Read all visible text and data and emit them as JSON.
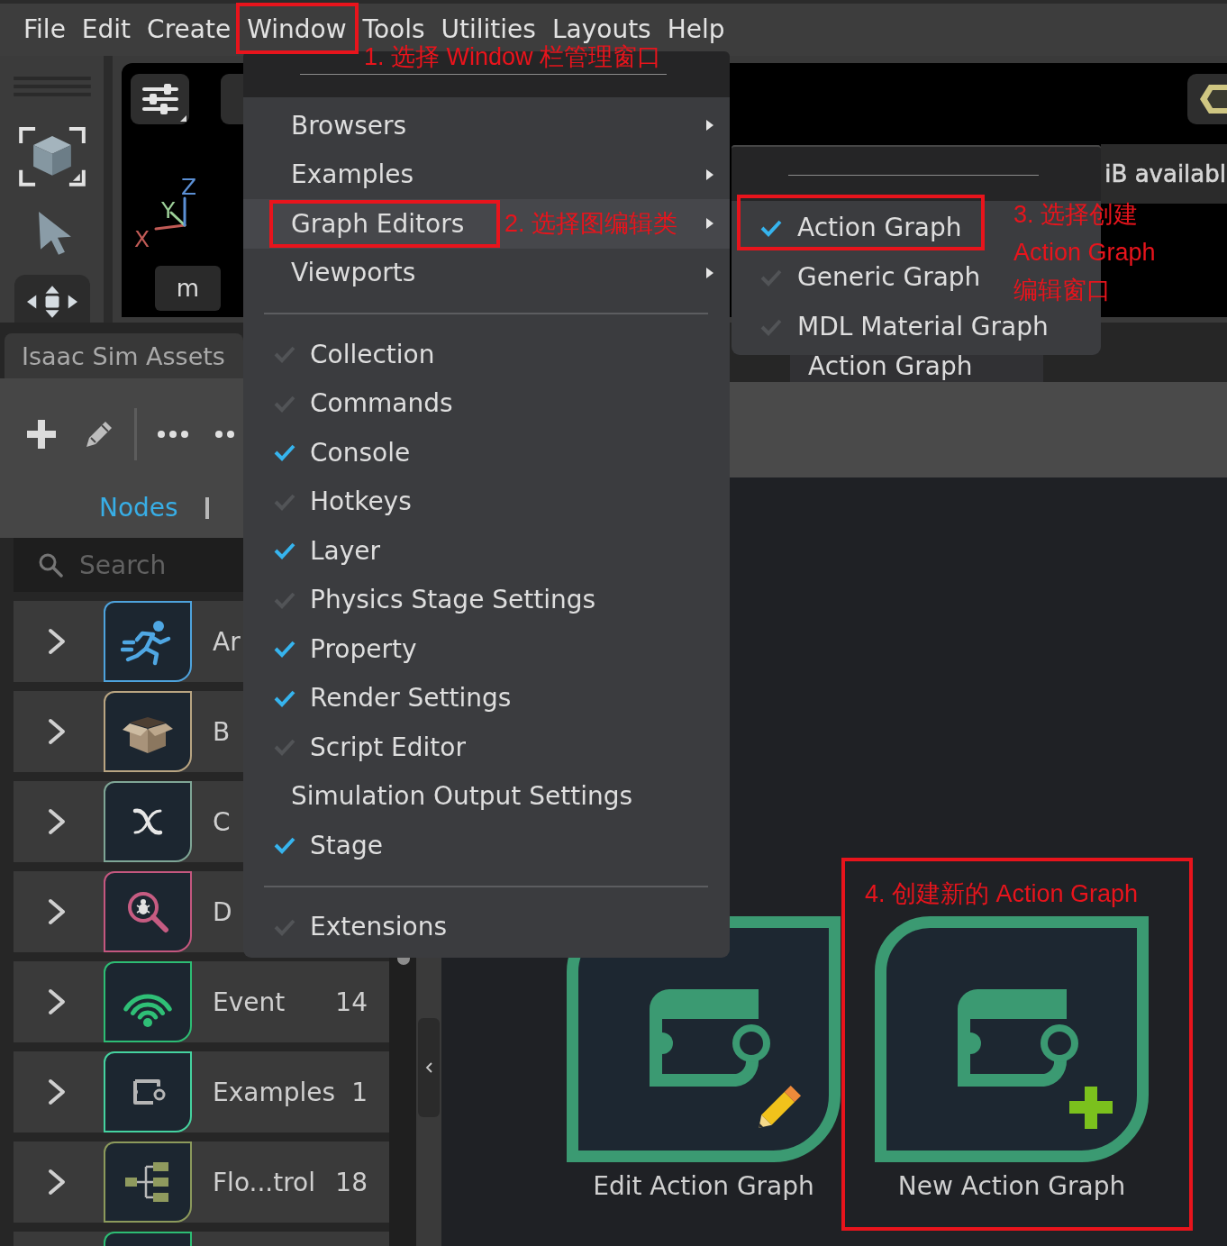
{
  "menu_bar": [
    "File",
    "Edit",
    "Create",
    "Window",
    "Tools",
    "Utilities",
    "Layouts",
    "Help"
  ],
  "viewport": {
    "axes": [
      {
        "label": "X",
        "color": "#c05a55"
      },
      {
        "label": "Y",
        "color": "#9ccf98"
      },
      {
        "label": "Z",
        "color": "#5b8fd4"
      }
    ],
    "units": "m",
    "hud_text": "iB availabl"
  },
  "assets_panel": {
    "tab": "Isaac Sim Assets",
    "view_tabs": [
      {
        "label": "Nodes",
        "selected": true
      }
    ],
    "search": {
      "placeholder": "Search"
    },
    "rows": [
      {
        "kind": "runner",
        "label": "Ar",
        "color": "#4ea3dd"
      },
      {
        "kind": "box",
        "label": "B",
        "color": "#b9a582"
      },
      {
        "kind": "x",
        "label": "C",
        "color": "#7fa696"
      },
      {
        "kind": "bug",
        "label": "D",
        "color": "#c4577f"
      },
      {
        "kind": "signal",
        "label": "Event",
        "count": "14",
        "color": "#2dbd74"
      },
      {
        "kind": "node",
        "label": "Examples",
        "count": "1",
        "color": "#45d3a0"
      },
      {
        "kind": "tree",
        "label": "Flo...trol",
        "count": "18",
        "color": "#8c9a5c"
      },
      {
        "kind": "blank",
        "color": "#2dbd74"
      }
    ]
  },
  "graph_panel": {
    "tab": "Action Graph",
    "cards": [
      {
        "kind": "edit",
        "label": "Edit Action Graph"
      },
      {
        "kind": "new",
        "label": "New Action Graph"
      }
    ]
  },
  "window_menu": {
    "sections": [
      {
        "items": [
          {
            "label": "Browsers",
            "kind": "submenu",
            "selected": false
          },
          {
            "label": "Examples",
            "kind": "submenu",
            "selected": false
          },
          {
            "label": "Graph Editors",
            "kind": "submenu",
            "selected": true
          },
          {
            "label": "Viewports",
            "kind": "submenu",
            "selected": false
          }
        ]
      },
      {
        "items": [
          {
            "label": "Collection",
            "kind": "check",
            "checked": false,
            "selected": false
          },
          {
            "label": "Commands",
            "kind": "check",
            "checked": false,
            "selected": false
          },
          {
            "label": "Console",
            "kind": "check",
            "checked": true,
            "selected": false
          },
          {
            "label": "Hotkeys",
            "kind": "check",
            "checked": false,
            "selected": false
          },
          {
            "label": "Layer",
            "kind": "check",
            "checked": true,
            "selected": false
          },
          {
            "label": "Physics Stage Settings",
            "kind": "check",
            "checked": false,
            "selected": false
          },
          {
            "label": "Property",
            "kind": "check",
            "checked": true,
            "selected": false
          },
          {
            "label": "Render Settings",
            "kind": "check",
            "checked": true,
            "selected": false
          },
          {
            "label": "Script Editor",
            "kind": "check",
            "checked": false,
            "selected": false
          },
          {
            "label": "Simulation Output Settings",
            "kind": "action",
            "selected": false
          },
          {
            "label": "Stage",
            "kind": "check",
            "checked": true,
            "selected": false
          }
        ]
      },
      {
        "items": [
          {
            "label": "Extensions",
            "kind": "check",
            "checked": false,
            "selected": false
          }
        ]
      }
    ]
  },
  "graph_editors_menu": {
    "items": [
      {
        "label": "Action Graph",
        "checked": true
      },
      {
        "label": "Generic Graph",
        "checked": false
      },
      {
        "label": "MDL Material Graph",
        "checked": false
      }
    ]
  },
  "annotations": [
    {
      "lines": [
        "1. 选择 Window 栏管理窗口"
      ]
    },
    {
      "lines": [
        "2. 选择图编辑类"
      ]
    },
    {
      "lines": [
        "3. 选择创建",
        "Action Graph",
        "编辑窗口"
      ]
    },
    {
      "lines": [
        "4. 创建新的 Action Graph"
      ]
    }
  ]
}
